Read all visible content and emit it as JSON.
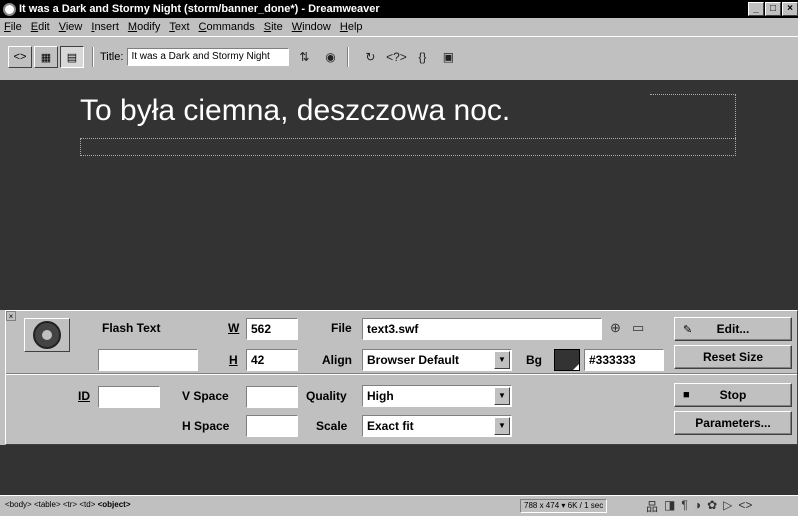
{
  "window": {
    "title": "It was a Dark and Stormy Night (storm/banner_done*) - Dreamweaver",
    "controls": [
      "_",
      "□",
      "×"
    ]
  },
  "menu": [
    "File",
    "Edit",
    "View",
    "Insert",
    "Modify",
    "Text",
    "Commands",
    "Site",
    "Window",
    "Help"
  ],
  "toolbar": {
    "title_label": "Title:",
    "title_value": "It was a Dark and Stormy Night",
    "view_buttons": [
      "code-view-icon",
      "split-view-icon",
      "design-view-icon"
    ],
    "icons": [
      "file-management-icon",
      "preview-browser-icon",
      "refresh-icon",
      "reference-icon",
      "code-navigation-icon",
      "view-options-icon"
    ]
  },
  "document": {
    "headline": "To była ciemna, deszczowa noc.",
    "background": "#333333"
  },
  "properties": {
    "type_label": "Flash Text",
    "name_value": "",
    "w_label": "W",
    "w_value": "562",
    "h_label": "H",
    "h_value": "42",
    "file_label": "File",
    "file_value": "text3.swf",
    "align_label": "Align",
    "align_value": "Browser Default",
    "bg_label": "Bg",
    "bg_value": "#333333",
    "edit_button": "Edit...",
    "reset_button": "Reset Size",
    "id_label": "ID",
    "id_value": "",
    "vspace_label": "V Space",
    "vspace_value": "",
    "hspace_label": "H Space",
    "hspace_value": "",
    "quality_label": "Quality",
    "quality_value": "High",
    "scale_label": "Scale",
    "scale_value": "Exact fit",
    "stop_button": "Stop",
    "parameters_button": "Parameters..."
  },
  "statusbar": {
    "tags": [
      "<body>",
      "<table>",
      "<tr>",
      "<td>"
    ],
    "active_tag": "<object>",
    "size_info": "788 x 474",
    "download_info": "6K / 1 sec"
  }
}
